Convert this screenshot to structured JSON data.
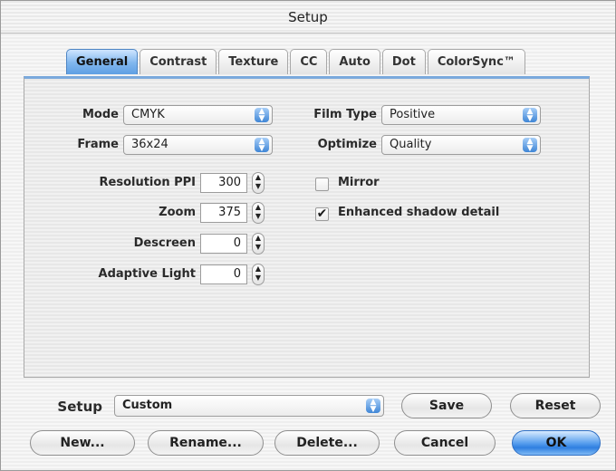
{
  "window": {
    "title": "Setup"
  },
  "tabs": [
    "General",
    "Contrast",
    "Texture",
    "CC",
    "Auto",
    "Dot",
    "ColorSync™"
  ],
  "general": {
    "mode": {
      "label": "Mode",
      "value": "CMYK"
    },
    "frame": {
      "label": "Frame",
      "value": "36x24"
    },
    "film_type": {
      "label": "Film Type",
      "value": "Positive"
    },
    "optimize": {
      "label": "Optimize",
      "value": "Quality"
    },
    "resolution": {
      "label": "Resolution PPI",
      "value": "300"
    },
    "zoom": {
      "label": "Zoom",
      "value": "375"
    },
    "descreen": {
      "label": "Descreen",
      "value": "0"
    },
    "adaptive_light": {
      "label": "Adaptive Light",
      "value": "0"
    },
    "mirror": {
      "label": "Mirror",
      "checked": false
    },
    "enhanced_shadow": {
      "label": "Enhanced shadow detail",
      "checked": true
    }
  },
  "footer": {
    "setup_label": "Setup",
    "setup_value": "Custom",
    "save": "Save",
    "reset": "Reset",
    "new": "New...",
    "rename": "Rename...",
    "delete": "Delete...",
    "cancel": "Cancel",
    "ok": "OK"
  },
  "colors": {
    "accent": "#3f86d6",
    "default_button": "#2f7fe0"
  }
}
